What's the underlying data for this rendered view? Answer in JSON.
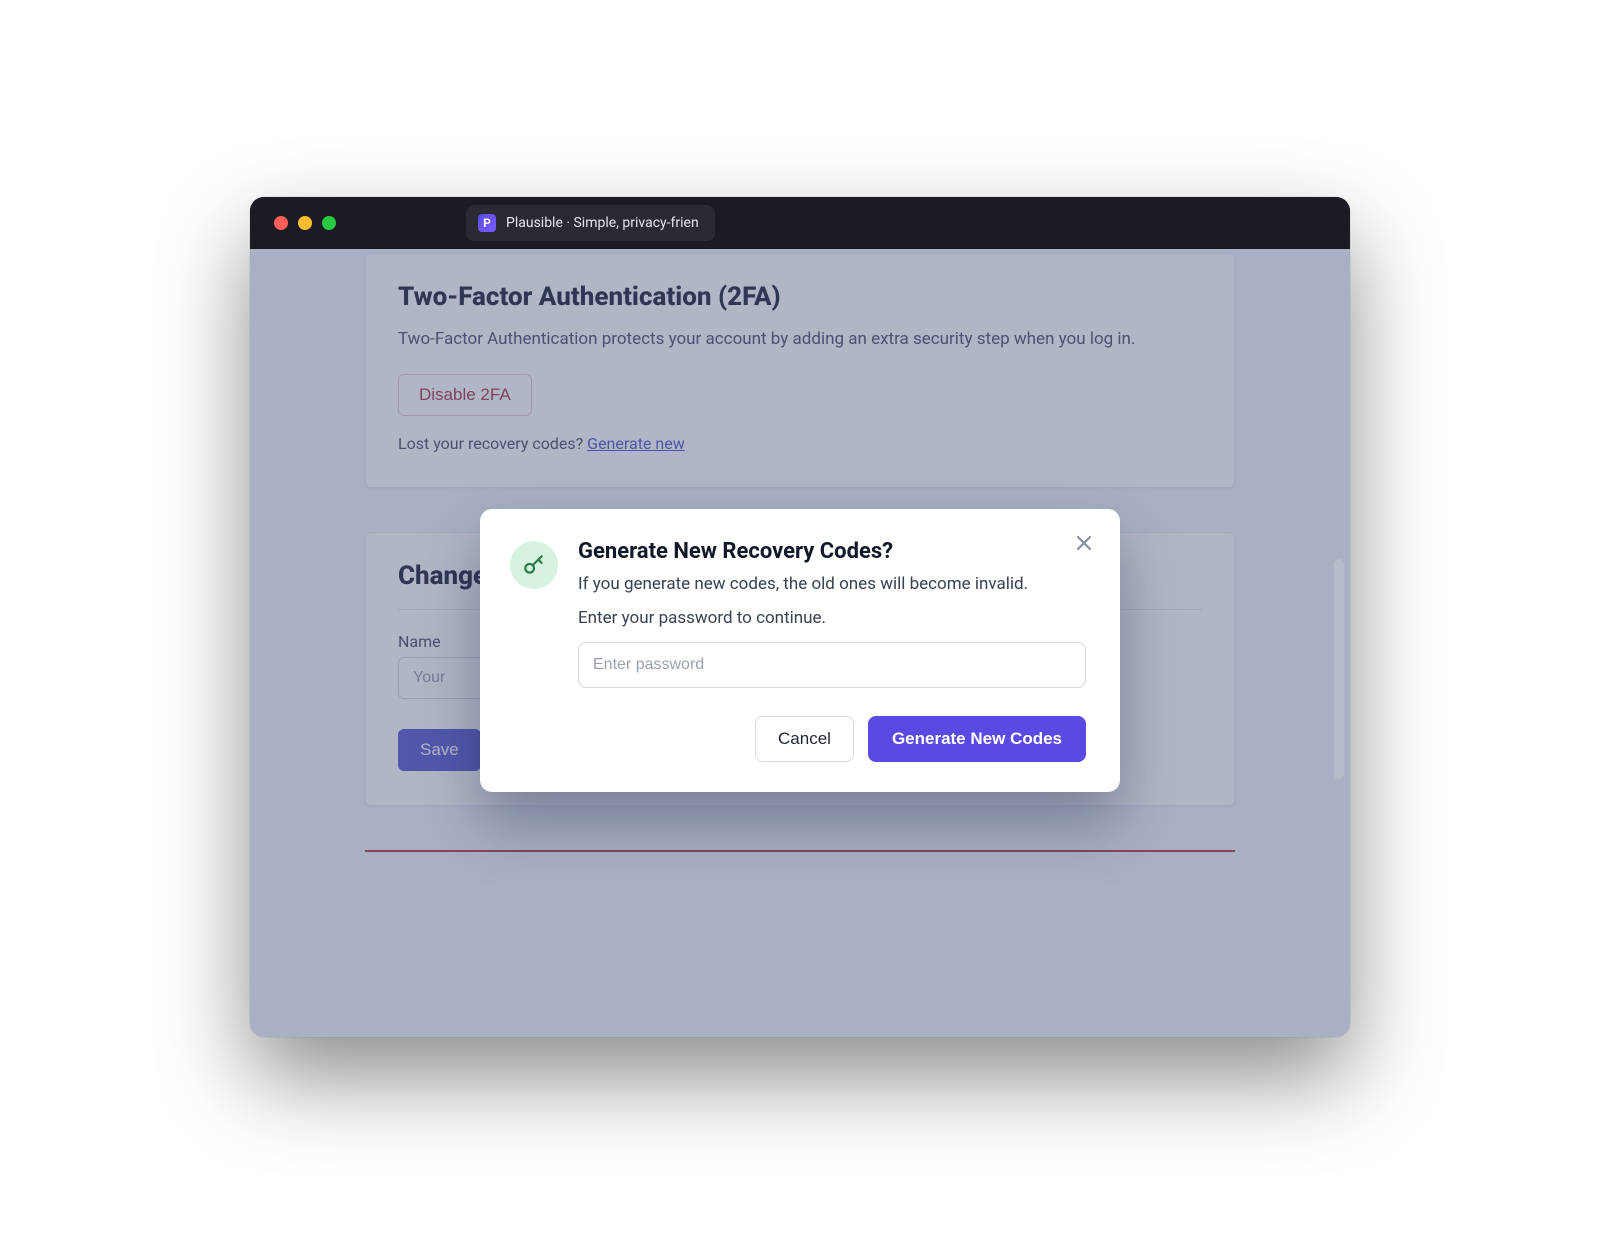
{
  "browser": {
    "tab_title": "Plausible · Simple, privacy-frien"
  },
  "two_factor": {
    "heading": "Two-Factor Authentication (2FA)",
    "description": "Two-Factor Authentication protects your account by adding an extra security step when you log in.",
    "disable_label": "Disable 2FA",
    "recovery_prefix": "Lost your recovery codes? ",
    "recovery_link": "Generate new"
  },
  "change_name": {
    "heading": "Change",
    "name_label": "Name",
    "name_placeholder": "Your",
    "save_label": "Save"
  },
  "modal": {
    "title": "Generate New Recovery Codes?",
    "line1": "If you generate new codes, the old ones will become invalid.",
    "line2": "Enter your password to continue.",
    "password_placeholder": "Enter password",
    "cancel_label": "Cancel",
    "confirm_label": "Generate New Codes"
  }
}
